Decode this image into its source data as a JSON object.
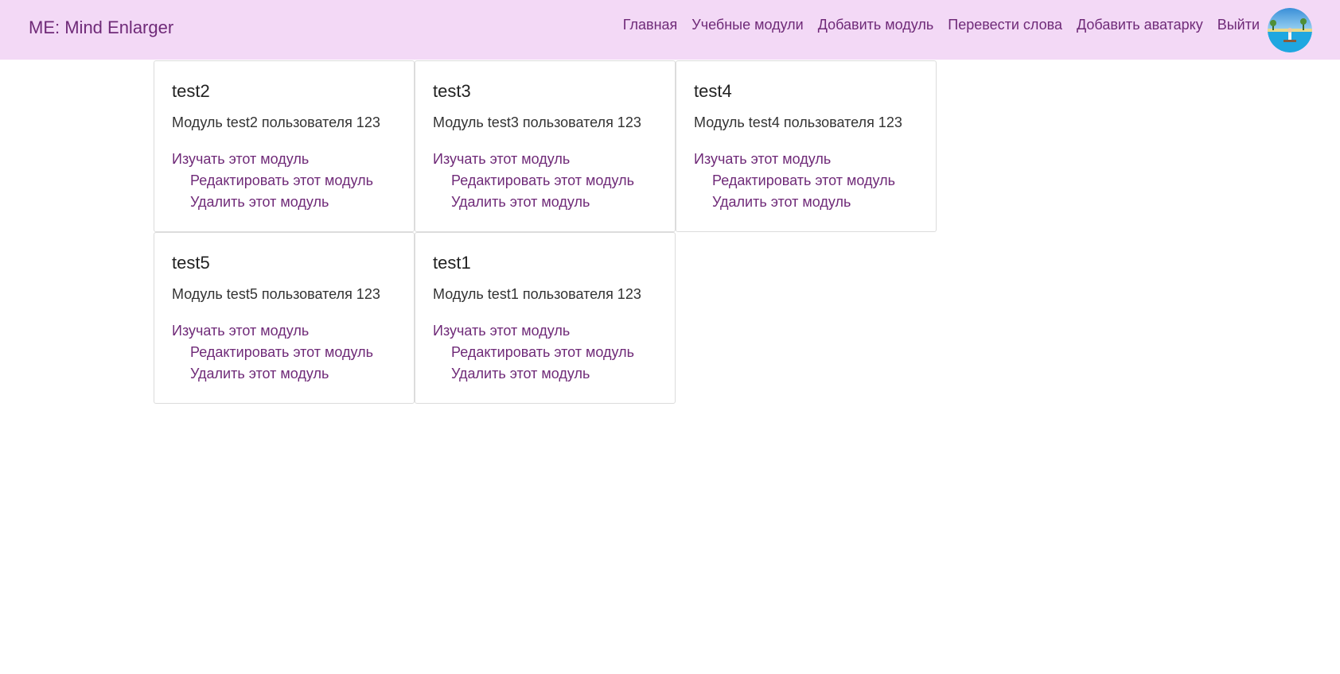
{
  "navbar": {
    "brand": "ME: Mind Enlarger",
    "links": [
      "Главная",
      "Учебные модули",
      "Добавить модуль",
      "Перевести слова",
      "Добавить аватарку",
      "Выйти"
    ],
    "avatar_icon": "avatar-image"
  },
  "modules": [
    {
      "title": "test2",
      "description": "Модуль test2 пользователя 123",
      "study": "Изучать этот модуль",
      "edit": "Редактировать этот модуль",
      "delete": "Удалить этот модуль"
    },
    {
      "title": "test3",
      "description": "Модуль test3 пользователя 123",
      "study": "Изучать этот модуль",
      "edit": "Редактировать этот модуль",
      "delete": "Удалить этот модуль"
    },
    {
      "title": "test4",
      "description": "Модуль test4 пользователя 123",
      "study": "Изучать этот модуль",
      "edit": "Редактировать этот модуль",
      "delete": "Удалить этот модуль"
    },
    {
      "title": "test5",
      "description": "Модуль test5 пользователя 123",
      "study": "Изучать этот модуль",
      "edit": "Редактировать этот модуль",
      "delete": "Удалить этот модуль"
    },
    {
      "title": "test1",
      "description": "Модуль test1 пользователя 123",
      "study": "Изучать этот модуль",
      "edit": "Редактировать этот модуль",
      "delete": "Удалить этот модуль"
    }
  ],
  "colors": {
    "navbar_bg": "#f3d9f6",
    "link": "#6f2a78",
    "card_border": "#dcdcdc"
  }
}
